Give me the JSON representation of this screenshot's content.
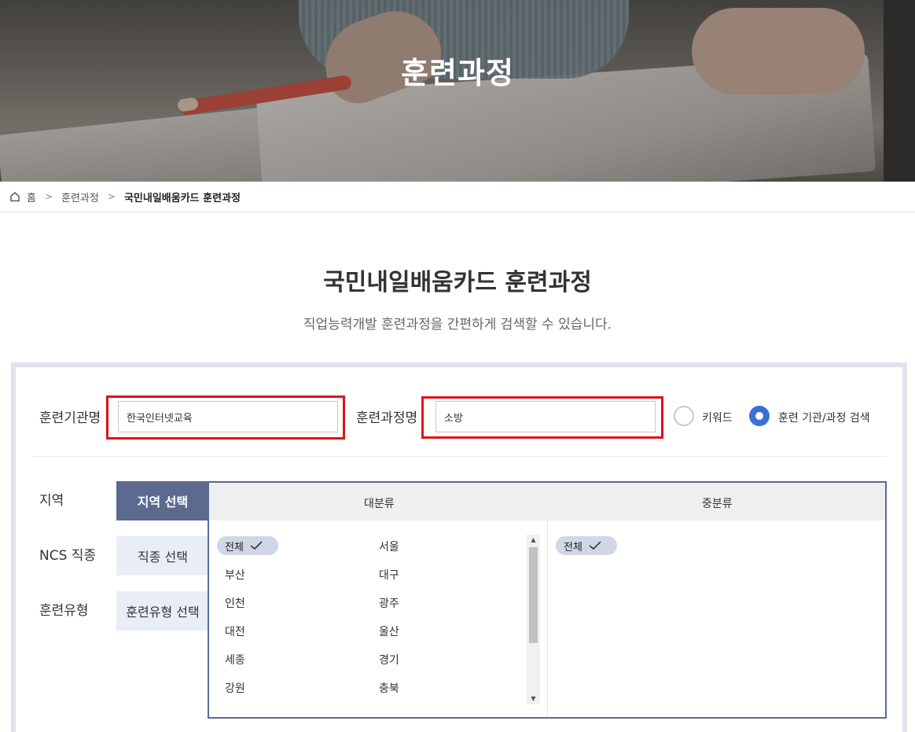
{
  "hero": {
    "title": "훈련과정"
  },
  "breadcrumb": {
    "home": "홈",
    "items": [
      "훈련과정",
      "국민내일배움카드 훈련과정"
    ]
  },
  "page": {
    "title": "국민내일배움카드 훈련과정",
    "subtitle": "직업능력개발 훈련과정을 간편하게 검색할 수 있습니다."
  },
  "search": {
    "institution_label": "훈련기관명",
    "institution_value": "한국인터넷교육",
    "course_label": "훈련과정명",
    "course_value": "소방",
    "radio_keyword": "키워드",
    "radio_institution": "훈련 기관/과정 검색",
    "selected_radio": "institution"
  },
  "filters": {
    "region_label": "지역",
    "ncs_label": "NCS 직종",
    "type_label": "훈련유형",
    "region_btn": "지역 선택",
    "ncs_btn": "직종 선택",
    "type_btn": "훈련유형 선택"
  },
  "panel": {
    "major_header": "대분류",
    "minor_header": "중분류",
    "major_items": [
      "전체",
      "서울",
      "부산",
      "대구",
      "인천",
      "광주",
      "대전",
      "울산",
      "세종",
      "경기",
      "강원",
      "충북"
    ],
    "selected_major": "전체",
    "minor_items": [
      "전체"
    ],
    "selected_minor": "전체"
  },
  "colors": {
    "accent": "#5c6a90",
    "highlight": "#e0101a",
    "radio_on": "#3b6fd8"
  }
}
